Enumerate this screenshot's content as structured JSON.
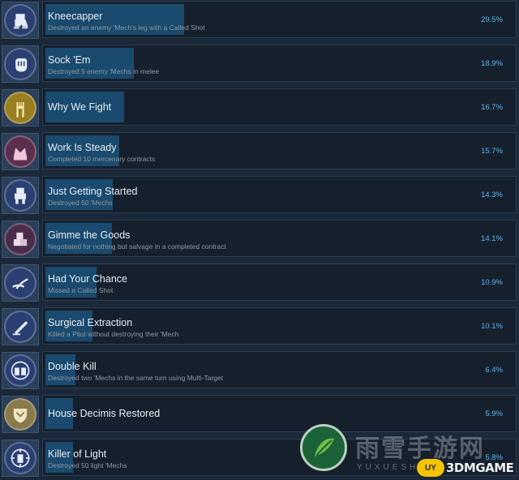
{
  "achievements": [
    {
      "icon": "kneecapper-mech-icon",
      "title": "Kneecapper",
      "description": "Destroyed an enemy 'Mech's leg with a Called Shot",
      "percent": "29.5%",
      "fraction": 0.295,
      "color": "#2b3f73"
    },
    {
      "icon": "fist-icon",
      "title": "Sock 'Em",
      "description": "Destroyed 5 enemy 'Mechs in melee",
      "percent": "18.9%",
      "fraction": 0.189,
      "color": "#2b3f73"
    },
    {
      "icon": "raised-fist-icon",
      "title": "Why We Fight",
      "description": "",
      "percent": "16.7%",
      "fraction": 0.167,
      "color": "#9a7f22"
    },
    {
      "icon": "crown-icon",
      "title": "Work Is Steady",
      "description": "Completed 10 mercenary contracts",
      "percent": "15.7%",
      "fraction": 0.157,
      "color": "#5c2f4f"
    },
    {
      "icon": "mech-50-icon",
      "title": "Just Getting Started",
      "description": "Destroyed 50 'Mechs",
      "percent": "14.3%",
      "fraction": 0.143,
      "color": "#2b3f73"
    },
    {
      "icon": "salvage-crates-icon",
      "title": "Gimme the Goods",
      "description": "Negotiated for nothing but salvage in a completed contract",
      "percent": "14.1%",
      "fraction": 0.141,
      "color": "#4a2d4a"
    },
    {
      "icon": "missed-shot-icon",
      "title": "Had Your Chance",
      "description": "Missed a Called Shot",
      "percent": "10.9%",
      "fraction": 0.109,
      "color": "#2b3f73"
    },
    {
      "icon": "scalpel-icon",
      "title": "Surgical Extraction",
      "description": "Killed a Pilot without destroying their 'Mech",
      "percent": "10.1%",
      "fraction": 0.101,
      "color": "#2b3f73"
    },
    {
      "icon": "double-target-icon",
      "title": "Double Kill",
      "description": "Destroyed two 'Mechs in the same turn using Multi-Target",
      "percent": "6.4%",
      "fraction": 0.064,
      "color": "#2b3f73"
    },
    {
      "icon": "house-crest-icon",
      "title": "House Decimis Restored",
      "description": "",
      "percent": "5.9%",
      "fraction": 0.059,
      "color": "#8a7a4a"
    },
    {
      "icon": "crosshair-mech-icon",
      "title": "Killer of Light",
      "description": "Destroyed 50 light 'Mechs",
      "percent": "5.8%",
      "fraction": 0.058,
      "color": "#2b3f73"
    }
  ],
  "watermark": {
    "site_cn": "雨雪手游网",
    "site_en": "YUXUESHOU",
    "badge": "UY",
    "brand": "3DMGAME"
  }
}
